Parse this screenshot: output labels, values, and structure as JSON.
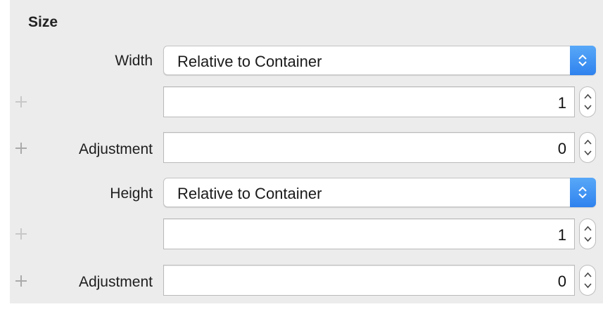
{
  "section": {
    "title": "Size"
  },
  "width": {
    "label": "Width",
    "mode": "Relative to Container",
    "multiplier": "1",
    "adjustment_label": "Adjustment",
    "adjustment": "0"
  },
  "height": {
    "label": "Height",
    "mode": "Relative to Container",
    "multiplier": "1",
    "adjustment_label": "Adjustment",
    "adjustment": "0"
  },
  "colors": {
    "accent": "#3a8ef2",
    "panel": "#ececec"
  },
  "icons": {
    "add": "plus-icon",
    "popup": "up-down-chevron-icon",
    "stepper": "stepper-arrows-icon"
  }
}
